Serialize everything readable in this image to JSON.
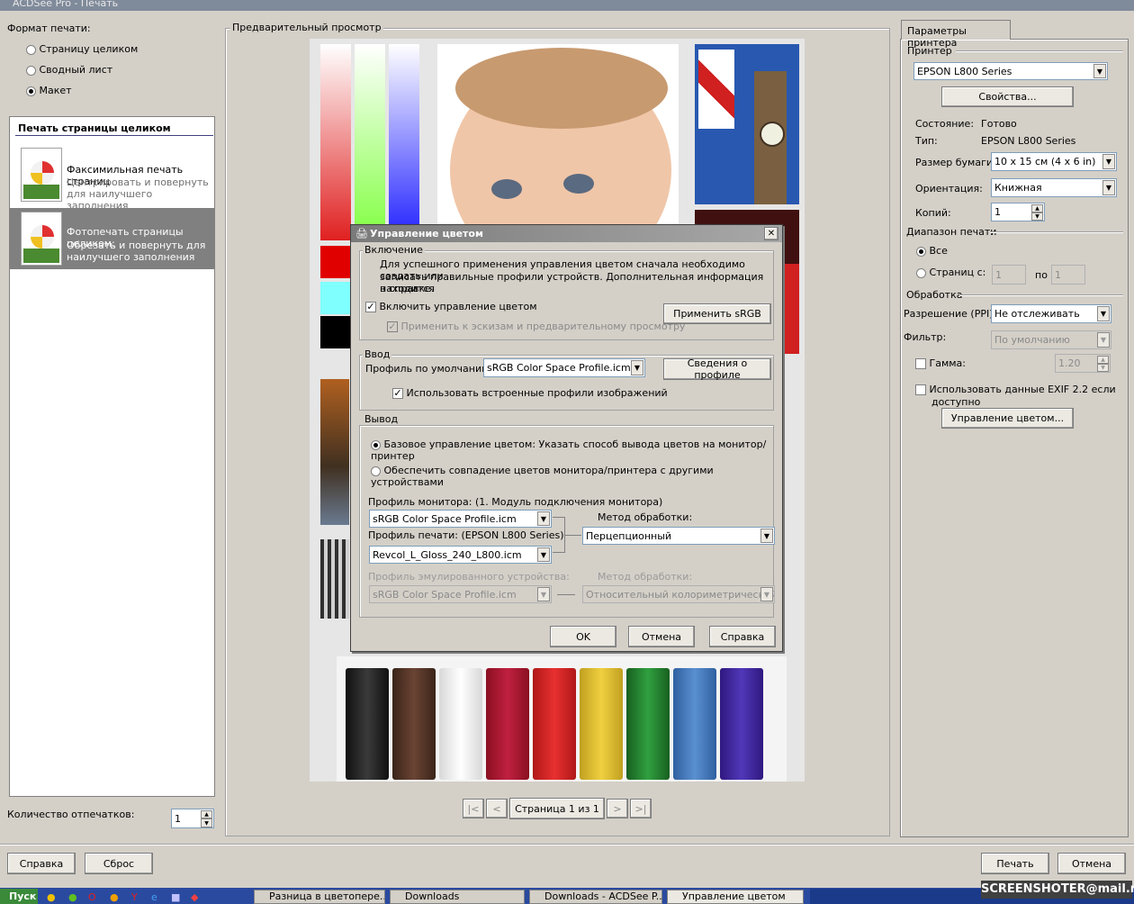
{
  "window": {
    "title": "ACDSee Pro - Печать"
  },
  "format": {
    "label": "Формат печати:",
    "options": [
      "Страницу целиком",
      "Сводный лист",
      "Макет"
    ],
    "selected": 2
  },
  "layout_list": {
    "header": "Печать страницы целиком",
    "items": [
      {
        "title": "Факсимильная печать страниц",
        "desc1": "Центрировать и повернуть",
        "desc2": "для наилучшего заполнения"
      },
      {
        "title": "Фотопечать страницы целиком:",
        "desc1": "Обрезать и повернуть для",
        "desc2": "наилучшего заполнения"
      }
    ]
  },
  "copies_count": {
    "label": "Количество отпечатков:",
    "value": "1"
  },
  "preview": {
    "label": "Предварительный просмотр"
  },
  "pager": {
    "first": "|<",
    "prev": "<",
    "page_text": "Страница 1 из 1",
    "next": ">",
    "last": ">|"
  },
  "printer_tab": {
    "tab_label": "Параметры принтера",
    "printer_label": "Принтер",
    "printer_value": "EPSON L800 Series",
    "properties_button": "Свойства...",
    "status_label": "Состояние:",
    "status_value": "Готово",
    "type_label": "Тип:",
    "type_value": "EPSON L800 Series",
    "paper_label": "Размер бумаги:",
    "paper_value": "10 x 15 см (4 x 6 in)",
    "orientation_label": "Ориентация:",
    "orientation_value": "Книжная",
    "copies_label": "Копий:",
    "copies_value": "1",
    "range_label": "Диапазон печати",
    "range_all": "Все",
    "range_pages": "Страниц с:",
    "range_from": "1",
    "range_to_label": "по",
    "range_to": "1",
    "processing_label": "Обработка",
    "resolution_label": "Разрешение (PPI):",
    "resolution_value": "Не отслеживать",
    "filter_label": "Фильтр:",
    "filter_value": "По умолчанию",
    "gamma_label": "Гамма:",
    "gamma_value": "1.20",
    "exif_label1": "Использовать данные EXIF 2.2 если",
    "exif_label2": "доступно",
    "color_mgmt_button": "Управление цветом..."
  },
  "bottom_buttons": {
    "help": "Справка",
    "reset": "Сброс",
    "print": "Печать",
    "cancel": "Отмена"
  },
  "dialog": {
    "title": "Управление цветом",
    "enable_group": "Включение",
    "info_line1": "Для успешного применения управления цветом сначала необходимо создать или",
    "info_line2": "записать правильные профили устройств. Дополнительная информация находится",
    "info_line3": "в справке.",
    "enable_cm": "Включить управление цветом",
    "apply_thumbs": "Применить к эскизам и предварительному просмотру",
    "apply_srgb": "Применить sRGB",
    "input_group": "Ввод",
    "default_profile_label": "Профиль по умолчанию:",
    "default_profile_value": "sRGB Color Space Profile.icm",
    "profile_info_button": "Сведения о профиле",
    "use_embedded": "Использовать встроенные профили изображений",
    "output_group": "Вывод",
    "basic_cm": "Базовое управление цветом: Указать способ вывода цветов на монитор/принтер",
    "match_colors": "Обеспечить совпадение цветов монитора/принтера с другими устройствами",
    "monitor_profile_label": "Профиль монитора: (1. Модуль подключения монитора)",
    "monitor_profile_value": "sRGB Color Space Profile.icm",
    "method_label": "Метод обработки:",
    "method_value": "Перцепционный",
    "print_profile_label": "Профиль печати: (EPSON L800 Series)",
    "print_profile_value": "Revcol_L_Gloss_240_L800.icm",
    "emulated_label": "Профиль эмулированного устройства:",
    "emulated_value": "sRGB Color Space Profile.icm",
    "method2_label": "Метод обработки:",
    "method2_value": "Относительный колориметрический",
    "ok": "OK",
    "cancel": "Отмена",
    "help": "Справка"
  },
  "taskbar": {
    "start": "Пуск",
    "items": [
      "Разница в цветопере...",
      "Downloads",
      "Downloads - ACDSee P...",
      "Управление цветом"
    ],
    "watermark": "SCREENSHOTER@mail.ru"
  },
  "colors": {
    "face": "#d4d0c8",
    "selected_row": "#808080",
    "taskbar": "#2a4aa0"
  }
}
